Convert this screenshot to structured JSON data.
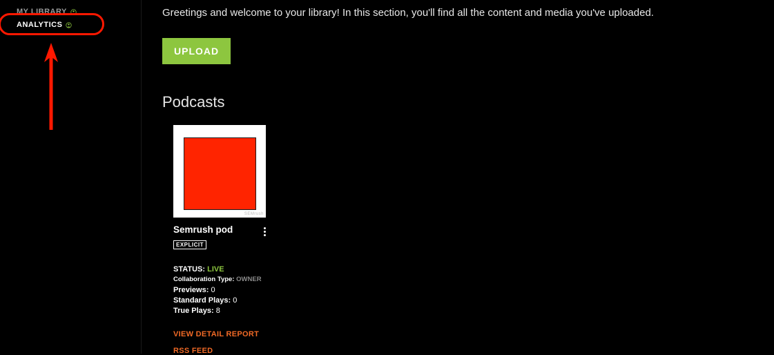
{
  "sidebar": {
    "my_library": "MY LIBRARY",
    "analytics": "ANALYTICS"
  },
  "main": {
    "welcome": "Greetings and welcome to your library! In this section, you'll find all the content and media you've uploaded.",
    "upload_label": "UPLOAD",
    "podcasts_heading": "Podcasts"
  },
  "card": {
    "title": "Semrush pod",
    "explicit": "EXPLICIT",
    "status_label": "STATUS:",
    "status_value": "LIVE",
    "collab_label": "Collaboration Type:",
    "collab_value": "OWNER",
    "previews_label": "Previews:",
    "previews_value": "0",
    "standard_label": "Standard Plays:",
    "standard_value": "0",
    "true_label": "True Plays:",
    "true_value": "8",
    "detail_link": "VIEW DETAIL REPORT",
    "rss_link": "RSS FEED"
  }
}
